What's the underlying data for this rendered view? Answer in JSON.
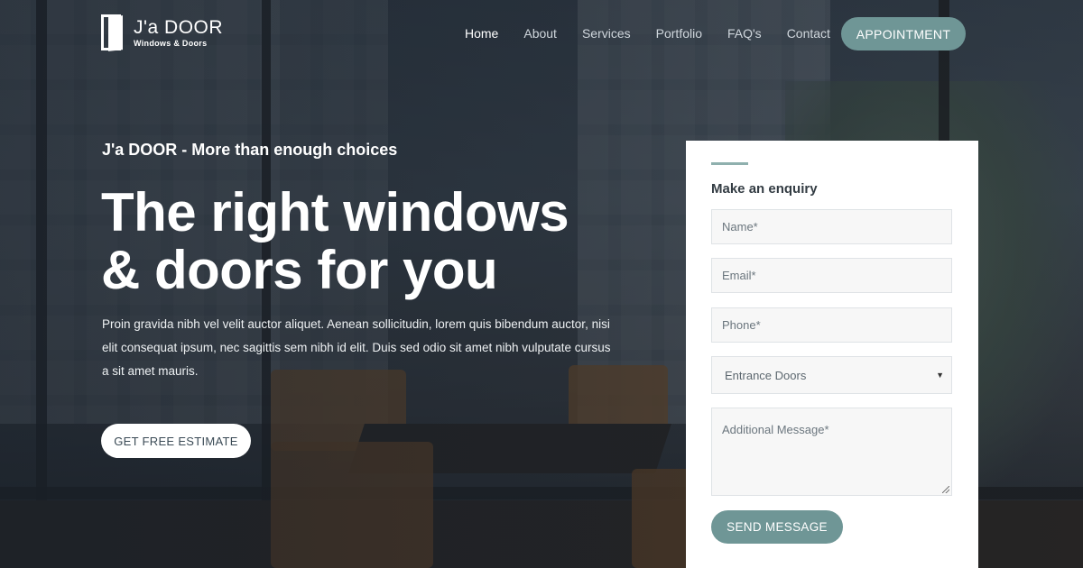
{
  "brand": {
    "name": "J'a DOOR",
    "tagline": "Windows & Doors"
  },
  "nav": {
    "items": [
      {
        "label": "Home",
        "active": true
      },
      {
        "label": "About"
      },
      {
        "label": "Services"
      },
      {
        "label": "Portfolio"
      },
      {
        "label": "FAQ's"
      },
      {
        "label": "Contact"
      }
    ],
    "appointment_label": "APPOINTMENT"
  },
  "hero": {
    "kicker": "J'a DOOR - More than enough choices",
    "title_line1": "The right windows",
    "title_line2": "& doors for you",
    "text": "Proin gravida nibh vel velit auctor aliquet. Aenean sollicitudin, lorem quis bibendum auctor, nisi elit consequat ipsum, nec sagittis sem nibh id elit. Duis sed odio sit amet nibh vulputate cursus a sit amet mauris.",
    "cta_label": "GET FREE ESTIMATE"
  },
  "enquiry": {
    "title": "Make an enquiry",
    "name_placeholder": "Name*",
    "email_placeholder": "Email*",
    "phone_placeholder": "Phone*",
    "select_value": "Entrance Doors",
    "message_placeholder": "Additional Message*",
    "submit_label": "SEND MESSAGE"
  },
  "colors": {
    "accent": "#6f9696",
    "accent_light": "#8fb0ae",
    "form_bg": "#ffffff",
    "overlay": "#18202a"
  },
  "icons": {
    "logo": "door-logo-icon",
    "select": "caret-down-icon",
    "textarea": "resize-handle-icon"
  }
}
